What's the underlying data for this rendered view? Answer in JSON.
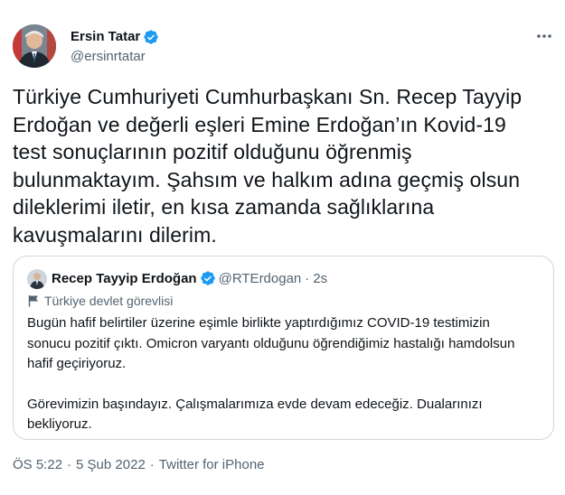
{
  "author": {
    "name": "Ersin Tatar",
    "handle": "@ersinrtatar",
    "verified": true
  },
  "tweet_text": [
    "Türkiye Cumhuriyeti Cumhurbaşkanı Sn. Recep Tayyip",
    "Erdoğan ve değerli eşleri Emine Erdoğan’ın Kovid-19",
    "test sonuçlarının pozitif olduğunu öğrenmiş",
    "bulunmaktayım. Şahsım ve halkım adına geçmiş olsun",
    "dileklerimi iletir, en kısa zamanda sağlıklarına",
    "kavuşmalarını dilerim."
  ],
  "quoted": {
    "name": "Recep Tayyip Erdoğan",
    "handle": "@RTErdogan",
    "separator": "·",
    "time": "2s",
    "label": "Türkiye devlet görevlisi",
    "paragraph1": [
      "Bugün hafif belirtiler üzerine eşimle birlikte yaptırdığımız COVID-19 testimizin",
      "sonucu pozitif çıktı. Omicron varyantı olduğunu öğrendiğimiz hastalığı hamdolsun",
      "hafif geçiriyoruz."
    ],
    "paragraph2": [
      "Görevimizin başındayız. Çalışmalarımıza evde devam edeceğiz. Dualarınızı",
      "bekliyoruz."
    ]
  },
  "meta": {
    "time": "ÖS 5:22",
    "separator": "·",
    "date": "5 Şub 2022",
    "source": "Twitter for iPhone"
  },
  "colors": {
    "verified": "#1d9bf0",
    "text_primary": "#0f1419",
    "text_secondary": "#536471",
    "border": "#cfd9de"
  },
  "icons": {
    "more": "more-horizontal-icon",
    "verified": "verified-badge-icon",
    "label": "flag-icon"
  }
}
